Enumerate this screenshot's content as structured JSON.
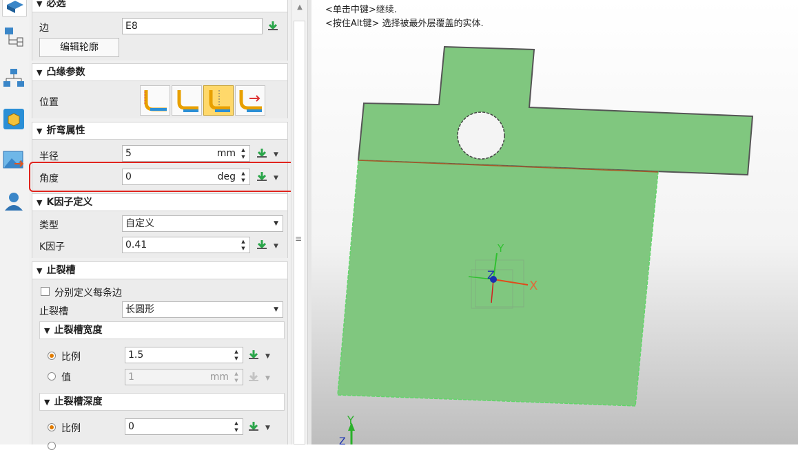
{
  "hints": [
    "<单击中键>继续.",
    "<按住Alt键> 选择被最外层覆盖的实体."
  ],
  "sections": {
    "required": {
      "title": "必选",
      "edge_label": "边",
      "edge_value": "E8",
      "edit_profile": "编辑轮廓"
    },
    "flange_params": {
      "title": "凸缘参数",
      "position_label": "位置"
    },
    "bend": {
      "title": "折弯属性",
      "radius_label": "半径",
      "radius_value": "5",
      "radius_unit": "mm",
      "angle_label": "角度",
      "angle_value": "0",
      "angle_unit": "deg"
    },
    "kfactor": {
      "title": "K因子定义",
      "type_label": "类型",
      "type_value": "自定义",
      "k_label": "K因子",
      "k_value": "0.41"
    },
    "relief": {
      "title": "止裂槽",
      "per_edge_label": "分别定义每条边",
      "relief_label": "止裂槽",
      "relief_value": "长圆形",
      "width": {
        "title": "止裂槽宽度",
        "ratio_label": "比例",
        "ratio_value": "1.5",
        "value_label": "值",
        "value_value": "1",
        "value_unit": "mm"
      },
      "depth": {
        "title": "止裂槽深度",
        "ratio_label": "比例",
        "ratio_value": "0"
      }
    }
  },
  "viewport": {
    "axis_x": "X",
    "axis_y": "Y",
    "axis_z": "Z",
    "corner_y": "Y",
    "corner_z": "Z"
  },
  "colors": {
    "part_fill": "#80c77f",
    "highlight": "#e0241e",
    "active_position": "#ffd86a"
  },
  "icons": [
    "part-icon",
    "assembly-tree-icon",
    "hierarchy-icon",
    "box-icon",
    "image-icon",
    "user-icon"
  ]
}
